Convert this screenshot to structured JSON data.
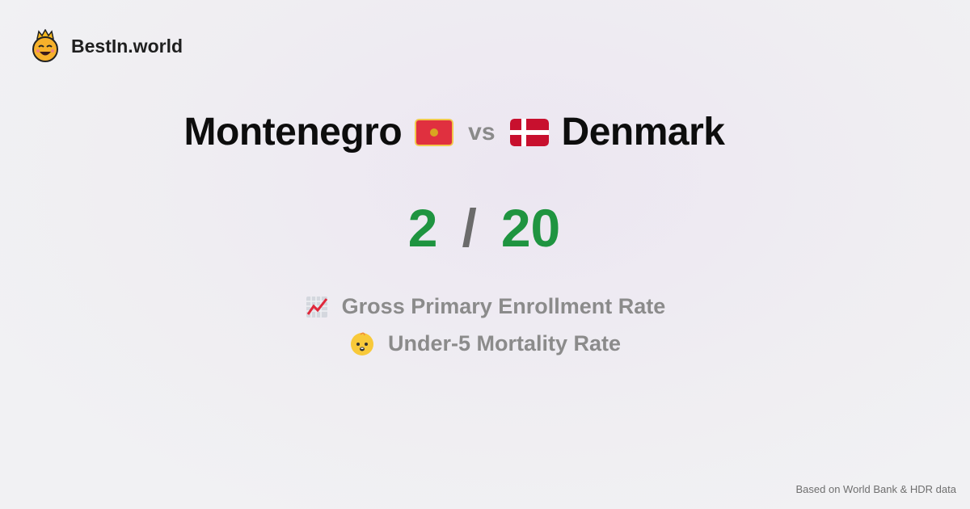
{
  "brand": {
    "name": "BestIn.world",
    "icon": "crowned-smiley-icon"
  },
  "comparison": {
    "left_country": "Montenegro",
    "left_flag": "montenegro-flag-icon",
    "vs": "vs",
    "right_country": "Denmark",
    "right_flag": "denmark-flag-icon"
  },
  "score": {
    "left": "2",
    "separator": "/",
    "right": "20"
  },
  "metrics": [
    {
      "icon": "chart-increasing-icon",
      "label": "Gross Primary Enrollment Rate"
    },
    {
      "icon": "baby-icon",
      "label": "Under-5 Mortality Rate"
    }
  ],
  "footer": {
    "text": "Based on World Bank & HDR data"
  },
  "colors": {
    "score": "#1f9440",
    "muted": "#8b8b8b"
  }
}
